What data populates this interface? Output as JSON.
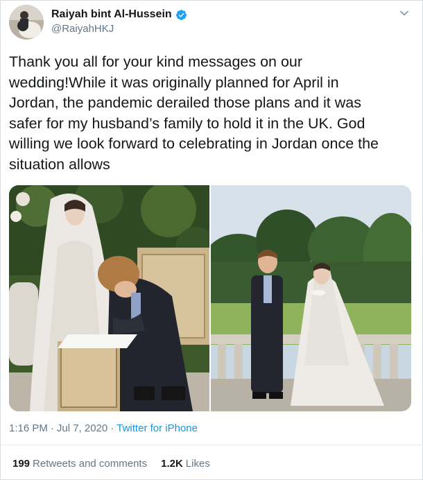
{
  "author": {
    "name": "Raiyah bint Al-Hussein",
    "handle": "@RaiyahHKJ",
    "verified": true
  },
  "tweet": {
    "text": "Thank you all for your kind messages on our\nwedding!While it was originally planned for April in\nJordan, the pandemic derailed those plans and it was\nsafer for my husband’s family to hold it in the UK. God\nwilling we look forward to celebrating in Jordan once the\nsituation allows",
    "time": "1:16 PM",
    "date": "Jul 7, 2020",
    "separator": "·",
    "source": "Twitter for iPhone"
  },
  "stats": {
    "retweets_count": "199",
    "retweets_label": "Retweets and comments",
    "likes_count": "1.2K",
    "likes_label": "Likes"
  },
  "colors": {
    "link": "#1b95e0",
    "secondary_text": "#657786",
    "primary_text": "#14171a",
    "verified": "#1da1f2"
  },
  "icons": {
    "verified": "verified-badge-icon",
    "menu": "chevron-down-icon"
  }
}
